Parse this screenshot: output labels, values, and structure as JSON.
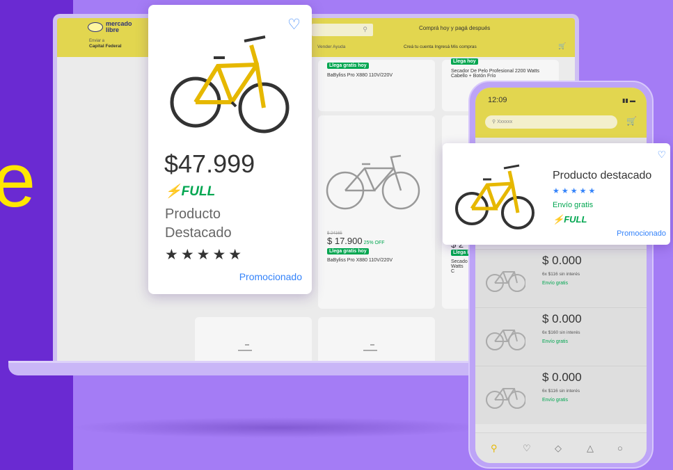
{
  "hero": {
    "letter": "e"
  },
  "desktop": {
    "logo_text": "mercado libre",
    "location_small": "Enviar a",
    "location": "Capital Federal",
    "search_icon": "search-icon",
    "promo_banner": "Comprá hoy y pagá después",
    "nav_left": "Vender   Ayuda",
    "nav_right": "Creá tu cuenta   Ingresá   Mis compras",
    "products": [
      {
        "badge": "Llega gratis hoy",
        "name": "BaByliss Pro X880 110V/220V"
      },
      {
        "badge": "Llega hoy",
        "name": "Secador De Pelo Profesional 2200 Watts Cabello + Botón Frío"
      },
      {
        "old_price": "$ 24165",
        "price": "$ 17.900",
        "off": "25% OFF",
        "badge": "Llega gratis hoy",
        "name": "BaByliss Pro X880 110V/220V"
      },
      {
        "price": "$ 2",
        "badge": "Llega h",
        "name": "Secado Watts C"
      }
    ]
  },
  "featured_card": {
    "price": "$47.999",
    "shipping": "FULL",
    "title": "Producto Destacado",
    "stars": "★★★★★",
    "promoted": "Promocionado"
  },
  "phone": {
    "time": "12:09",
    "search_placeholder": "Xxxxxx",
    "featured": {
      "title": "Producto destacado",
      "stars": "★★★★★",
      "shipping": "Envío gratis",
      "full": "FULL",
      "promoted": "Promocionado"
    },
    "items": [
      {
        "price": "$ 0.000",
        "installments": "6x $116 sin interés",
        "shipping": "Envío gratis"
      },
      {
        "price": "$ 0.000",
        "installments": "6x $160 sin interés",
        "shipping": "Envío gratis"
      },
      {
        "price": "$ 0.000",
        "installments": "6x $116 sin interés",
        "shipping": "Envío gratis"
      }
    ]
  },
  "colors": {
    "brand_yellow": "#ffe600",
    "purple": "#a47cf5",
    "green": "#00a650",
    "blue": "#3483fa"
  }
}
